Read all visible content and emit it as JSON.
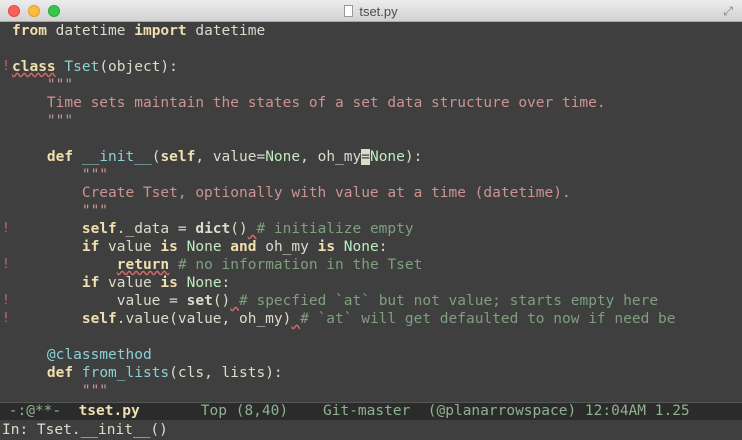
{
  "window": {
    "title": "tset.py"
  },
  "code": {
    "l1": {
      "k1": "from",
      "t1": " datetime ",
      "k2": "import",
      "t2": " datetime"
    },
    "l3": {
      "fringe": "!",
      "k1": "class",
      "t1": " ",
      "name": "Tset",
      "t2": "(object):"
    },
    "l4": {
      "indent": "    ",
      "s": "\"\"\""
    },
    "l5": {
      "indent": "    ",
      "s": "Time sets maintain the states of a set data structure over time."
    },
    "l6": {
      "indent": "    ",
      "s": "\"\"\""
    },
    "l8": {
      "indent": "    ",
      "k1": "def",
      "t1": " ",
      "name": "__init__",
      "t2": "(",
      "self": "self",
      "t3": ", value=",
      "b1": "None",
      "t4": ", oh_my",
      "cursor": "=",
      "b2": "None",
      "t5": "):"
    },
    "l9": {
      "indent": "        ",
      "s": "\"\"\""
    },
    "l10": {
      "indent": "        ",
      "s": "Create Tset, optionally with value at a time (datetime)."
    },
    "l11": {
      "indent": "        ",
      "s": "\"\"\""
    },
    "l12": {
      "fringe": "!",
      "indent": "        ",
      "self": "self",
      "t1": "._data = ",
      "bi": "dict",
      "t2": "()",
      "sq": " ",
      "c": "# initialize empty"
    },
    "l13": {
      "indent": "        ",
      "k1": "if",
      "t1": " value ",
      "k2": "is",
      "t2": " ",
      "b1": "None",
      "t3": " ",
      "k3": "and",
      "t4": " oh_my ",
      "k4": "is",
      "t5": " ",
      "b2": "None",
      "t6": ":"
    },
    "l14": {
      "fringe": "!",
      "indent": "            ",
      "k1": "return",
      "t1": " ",
      "c": "# no information in the Tset"
    },
    "l15": {
      "indent": "        ",
      "k1": "if",
      "t1": " value ",
      "k2": "is",
      "t2": " ",
      "b1": "None",
      "t3": ":"
    },
    "l16": {
      "fringe": "!",
      "indent": "            ",
      "t1": "value = ",
      "bi": "set",
      "t2": "()",
      "sq": " ",
      "c": "# specfied `at` but not value; starts empty here"
    },
    "l17": {
      "fringe": "!",
      "indent": "        ",
      "self": "self",
      "t1": ".value(value, oh_my)",
      "sq": " ",
      "c": "# `at` will get defaulted to now if need be"
    },
    "l19": {
      "indent": "    ",
      "d": "@classmethod"
    },
    "l20": {
      "indent": "    ",
      "k1": "def",
      "t1": " ",
      "name": "from_lists",
      "t2": "(cls, lists):"
    },
    "l21": {
      "indent": "        ",
      "s": "\"\"\""
    }
  },
  "modeline": {
    "status": " -:@**-  ",
    "buffer": "tset.py",
    "position": "       Top (8,40)",
    "vc": "    Git-master",
    "extra": "  (@planarrowspace) 12:04AM 1.25"
  },
  "minibuffer": {
    "text": "In: Tset.__init__()"
  }
}
